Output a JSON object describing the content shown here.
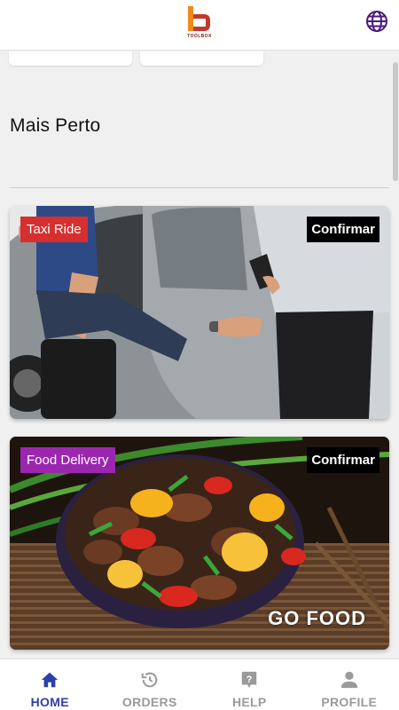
{
  "header": {
    "logo_text": "TOOLBOX",
    "logo_icon": "toolbox-logo-icon",
    "language_icon": "globe-icon"
  },
  "section": {
    "title": "Mais Perto"
  },
  "services": [
    {
      "badge": "Taxi Ride",
      "badge_color": "#d62f2f",
      "action": "Confirmar",
      "image": "taxi-ride-photo"
    },
    {
      "badge": "Food Delivery",
      "badge_color": "#9b27af",
      "action": "Confirmar",
      "image": "food-delivery-photo",
      "brand": "GO FOOD"
    }
  ],
  "tabs": [
    {
      "label": "HOME",
      "icon": "home-icon",
      "active": true
    },
    {
      "label": "ORDERS",
      "icon": "history-icon",
      "active": false
    },
    {
      "label": "HELP",
      "icon": "help-icon",
      "active": false
    },
    {
      "label": "PROFILE",
      "icon": "person-icon",
      "active": false
    }
  ],
  "colors": {
    "accent": "#2e3fa8",
    "header_icon": "#4a1a7a",
    "tab_inactive": "#9a9a9a"
  }
}
